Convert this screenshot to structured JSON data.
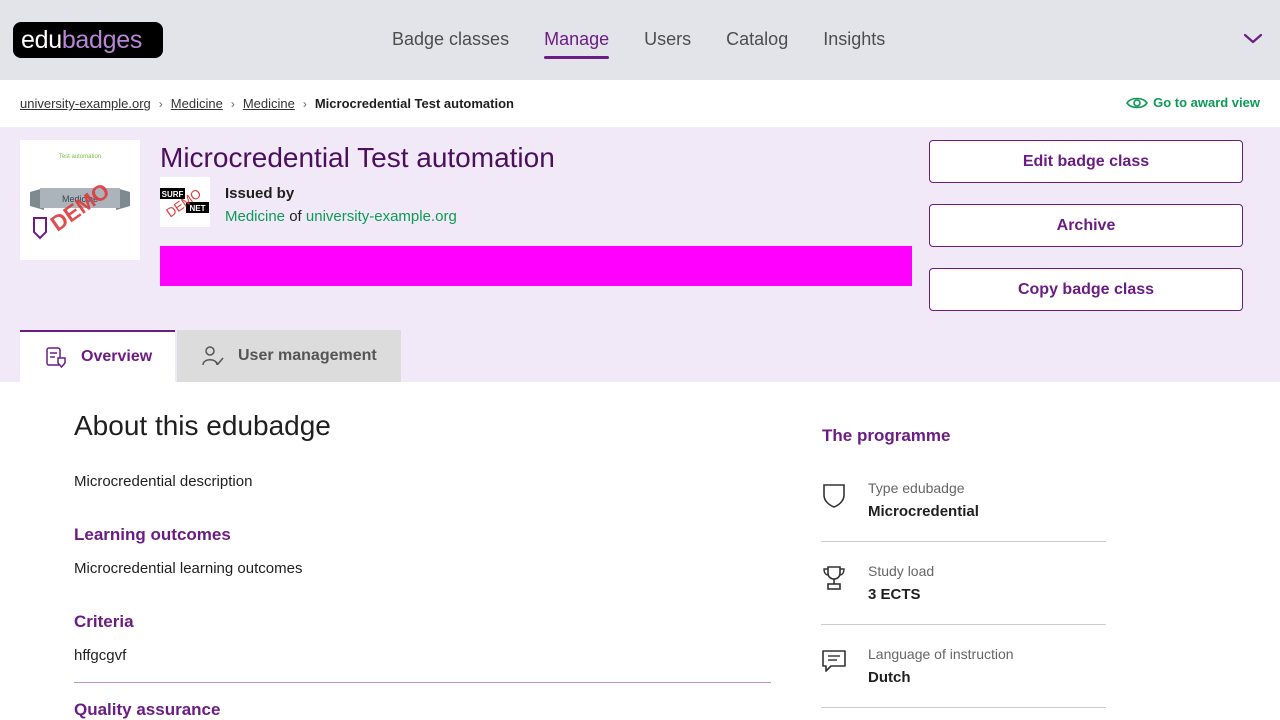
{
  "app": {
    "logo": {
      "part1": "edu",
      "part2": "badges"
    },
    "nav": [
      {
        "label": "Badge classes",
        "active": false
      },
      {
        "label": "Manage",
        "active": true
      },
      {
        "label": "Users",
        "active": false
      },
      {
        "label": "Catalog",
        "active": false
      },
      {
        "label": "Insights",
        "active": false
      }
    ],
    "nav_menu_icon": "chevron-down-icon"
  },
  "breadcrumb": {
    "items": [
      "university-example.org",
      "Medicine",
      "Medicine"
    ],
    "current": "Microcredential Test automation"
  },
  "award_view_link": "Go to award view",
  "header": {
    "title": "Microcredential Test automation",
    "badge_image": {
      "caption": "Test automation",
      "ribbon": "Medicine",
      "watermark": "DEMO"
    },
    "issuer_logo": {
      "surf": "SURF",
      "net": "NET",
      "watermark": "DEMO"
    },
    "issued_by_label": "Issued by",
    "issuer_faculty": "Medicine",
    "issuer_of": "of",
    "issuer_institution": "university-example.org",
    "banner_color": "#ff00ff"
  },
  "actions": {
    "edit": "Edit badge class",
    "archive": "Archive",
    "copy": "Copy badge class"
  },
  "tabs": [
    {
      "label": "Overview",
      "icon": "overview-icon",
      "active": true
    },
    {
      "label": "User management",
      "icon": "user-management-icon",
      "active": false
    }
  ],
  "about": {
    "title": "About this edubadge",
    "description": "Microcredential description",
    "learning_outcomes_heading": "Learning outcomes",
    "learning_outcomes": "Microcredential learning outcomes",
    "criteria_heading": "Criteria",
    "criteria": "hffgcgvf",
    "quality_heading": "Quality assurance"
  },
  "programme": {
    "title": "The programme",
    "items": [
      {
        "label": "Type edubadge",
        "value": "Microcredential",
        "icon": "shield-icon"
      },
      {
        "label": "Study load",
        "value": "3 ECTS",
        "icon": "trophy-icon"
      },
      {
        "label": "Language of instruction",
        "value": "Dutch",
        "icon": "chat-icon"
      }
    ]
  },
  "colors": {
    "brand_purple": "#6b1d83",
    "title_purple": "#4b0f5e",
    "link_green": "#0c9a55",
    "header_band": "#f1e9f7",
    "topbar": "#e2e4ea"
  }
}
